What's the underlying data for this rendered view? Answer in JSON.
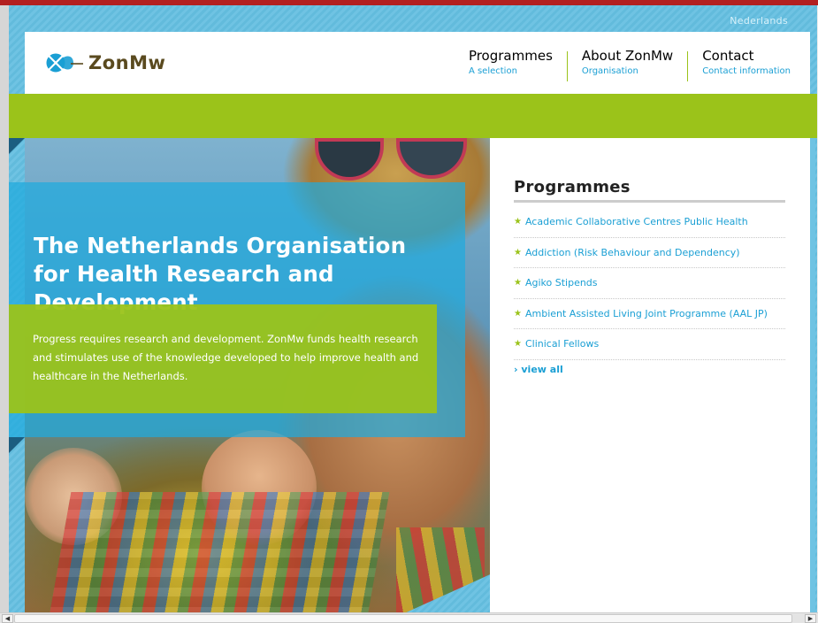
{
  "top_bar": {
    "language_link": "Nederlands"
  },
  "logo": {
    "text": "ZonMw",
    "icon": "zonmw-logo-icon"
  },
  "nav": [
    {
      "title": "Programmes",
      "subtitle": "A selection"
    },
    {
      "title": "About ZonMw",
      "subtitle": "Organisation"
    },
    {
      "title": "Contact",
      "subtitle": "Contact information"
    }
  ],
  "hero": {
    "title": "The Netherlands Organisation for Health Research and Development",
    "text": "Progress requires research and development. ZonMw funds health research and stimulates use of the knowledge developed to help improve health and healthcare in the Netherlands."
  },
  "programmes": {
    "heading": "Programmes",
    "items": [
      "Academic Collaborative Centres Public Health",
      "Addiction (Risk Behaviour and Dependency)",
      "Agiko Stipends",
      "Ambient Assisted Living Joint Programme (AAL JP)",
      "Clinical Fellows"
    ],
    "view_all": "view all"
  },
  "colors": {
    "accent_green": "#9bc31a",
    "accent_blue": "#1a9fd4",
    "background_blue": "#6fc3e3",
    "top_strip_red": "#b32020"
  }
}
